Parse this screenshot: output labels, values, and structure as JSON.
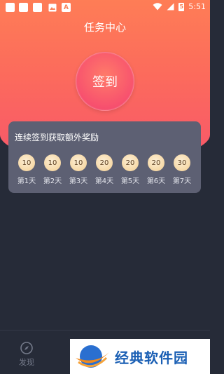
{
  "status_bar": {
    "time": "5:51",
    "left_icons": [
      "notification-icon",
      "notification-icon",
      "notification-icon",
      "image-icon",
      "letter-a-icon"
    ],
    "battery_glyph": "5"
  },
  "header": {
    "title": "任务中心",
    "signin_label": "签到"
  },
  "bonus_card": {
    "title": "连续签到获取额外奖励",
    "days": [
      {
        "value": "10",
        "label": "第1天"
      },
      {
        "value": "10",
        "label": "第2天"
      },
      {
        "value": "10",
        "label": "第3天"
      },
      {
        "value": "20",
        "label": "第4天"
      },
      {
        "value": "20",
        "label": "第5天"
      },
      {
        "value": "20",
        "label": "第6天"
      },
      {
        "value": "30",
        "label": "第7天"
      }
    ]
  },
  "bottom_nav": {
    "discover_label": "发现"
  },
  "watermark": {
    "text": "经典软件园"
  },
  "colors": {
    "header_top": "#fe7d56",
    "header_bottom": "#f7576a",
    "background": "#262b38",
    "card": "#5d6073",
    "coin": "#f6d8a6"
  }
}
